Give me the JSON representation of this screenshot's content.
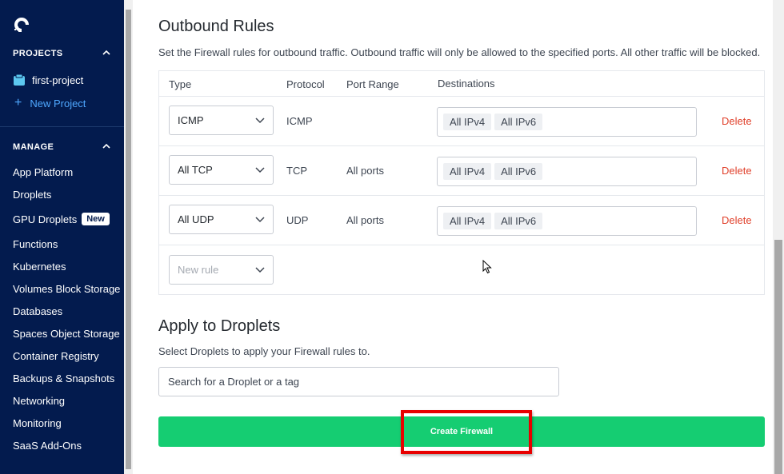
{
  "sidebar": {
    "projects_heading": "PROJECTS",
    "projects": [
      {
        "label": "first-project"
      },
      {
        "label": "New Project"
      }
    ],
    "manage_heading": "MANAGE",
    "nav": [
      {
        "label": "App Platform"
      },
      {
        "label": "Droplets"
      },
      {
        "label": "GPU Droplets",
        "badge": "New"
      },
      {
        "label": "Functions"
      },
      {
        "label": "Kubernetes"
      },
      {
        "label": "Volumes Block Storage"
      },
      {
        "label": "Databases"
      },
      {
        "label": "Spaces Object Storage"
      },
      {
        "label": "Container Registry"
      },
      {
        "label": "Backups & Snapshots"
      },
      {
        "label": "Networking"
      },
      {
        "label": "Monitoring"
      },
      {
        "label": "SaaS Add-Ons"
      }
    ]
  },
  "outbound": {
    "title": "Outbound Rules",
    "description": "Set the Firewall rules for outbound traffic. Outbound traffic will only be allowed to the specified ports. All other traffic will be blocked.",
    "columns": {
      "type": "Type",
      "protocol": "Protocol",
      "port_range": "Port Range",
      "destinations": "Destinations"
    },
    "rules": [
      {
        "type": "ICMP",
        "protocol": "ICMP",
        "port_range": "",
        "destinations": [
          "All IPv4",
          "All IPv6"
        ],
        "delete": "Delete"
      },
      {
        "type": "All TCP",
        "protocol": "TCP",
        "port_range": "All ports",
        "destinations": [
          "All IPv4",
          "All IPv6"
        ],
        "delete": "Delete"
      },
      {
        "type": "All UDP",
        "protocol": "UDP",
        "port_range": "All ports",
        "destinations": [
          "All IPv4",
          "All IPv6"
        ],
        "delete": "Delete"
      }
    ],
    "new_rule_placeholder": "New rule"
  },
  "apply": {
    "title": "Apply to Droplets",
    "description": "Select Droplets to apply your Firewall rules to.",
    "search_placeholder": "Search for a Droplet or a tag"
  },
  "create_button": "Create Firewall",
  "colors": {
    "sidebar_bg": "#031b4e",
    "accent_green": "#15cd72",
    "delete_red": "#e0412c",
    "link_blue": "#4fa8ff",
    "highlight_red": "#e80000"
  }
}
